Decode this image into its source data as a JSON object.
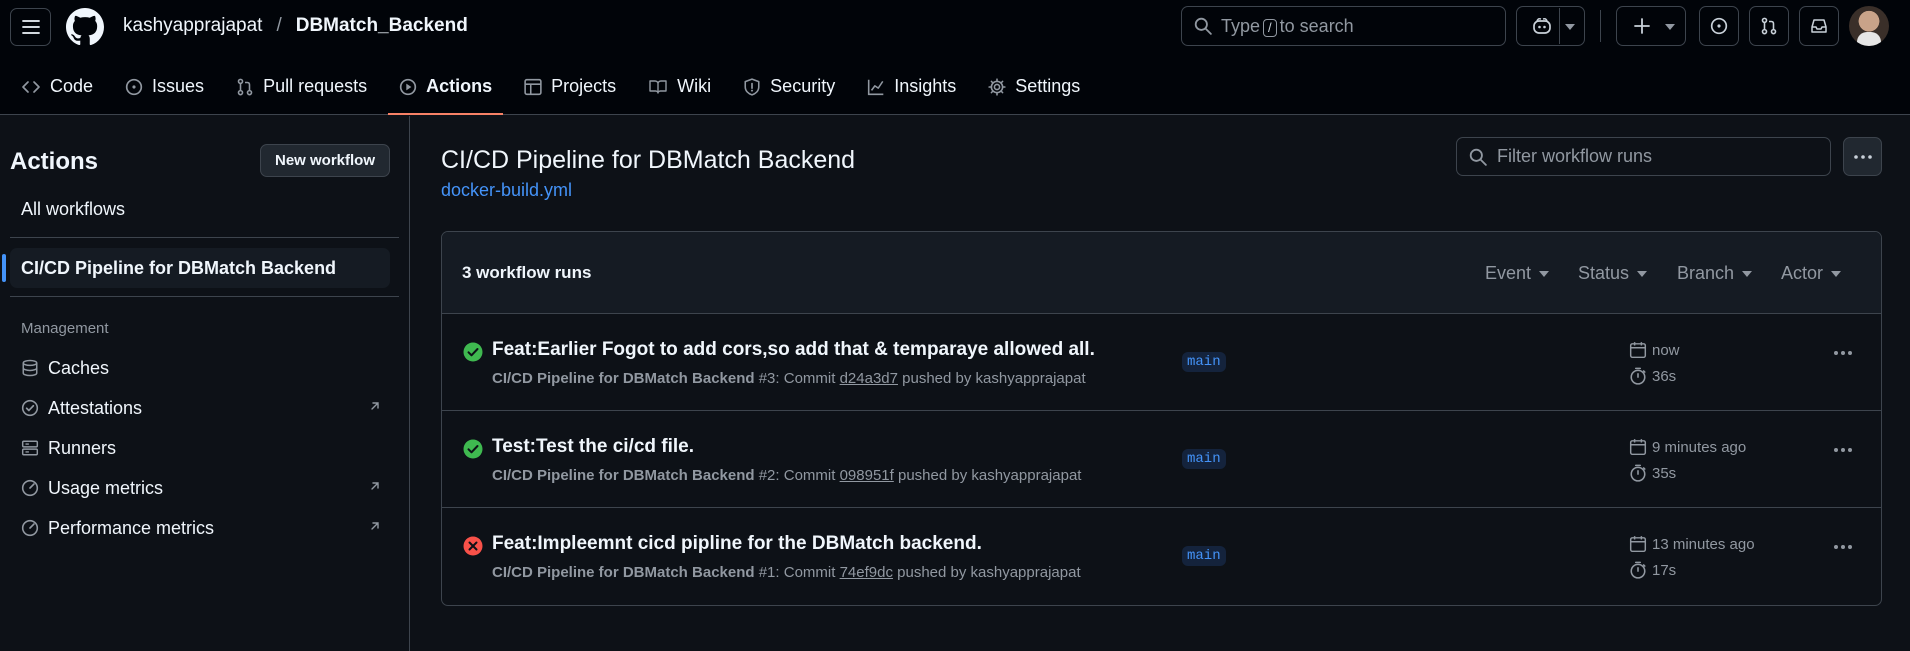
{
  "header": {
    "owner": "kashyapprajapat",
    "separator": "/",
    "repo": "DBMatch_Backend",
    "search_prefix": "Type",
    "search_key": "/",
    "search_suffix": "to search"
  },
  "nav": {
    "tabs": [
      {
        "label": "Code",
        "icon": "code-icon"
      },
      {
        "label": "Issues",
        "icon": "issue-icon"
      },
      {
        "label": "Pull requests",
        "icon": "pull-request-icon"
      },
      {
        "label": "Actions",
        "icon": "play-icon",
        "active": true
      },
      {
        "label": "Projects",
        "icon": "table-icon"
      },
      {
        "label": "Wiki",
        "icon": "book-icon"
      },
      {
        "label": "Security",
        "icon": "shield-icon"
      },
      {
        "label": "Insights",
        "icon": "graph-icon"
      },
      {
        "label": "Settings",
        "icon": "gear-icon"
      }
    ]
  },
  "sidebar": {
    "title": "Actions",
    "new_workflow": "New workflow",
    "all_workflows": "All workflows",
    "active_workflow": "CI/CD Pipeline for DBMatch Backend",
    "management_heading": "Management",
    "items": [
      {
        "label": "Caches",
        "icon": "cache-icon"
      },
      {
        "label": "Attestations",
        "icon": "verified-icon",
        "external": true
      },
      {
        "label": "Runners",
        "icon": "server-icon"
      },
      {
        "label": "Usage metrics",
        "icon": "meter-icon",
        "external": true
      },
      {
        "label": "Performance metrics",
        "icon": "meter-icon",
        "external": true
      }
    ]
  },
  "main": {
    "title": "CI/CD Pipeline for DBMatch Backend",
    "file": "docker-build.yml",
    "filter_placeholder": "Filter workflow runs",
    "runs_count": "3 workflow runs",
    "filters": [
      "Event",
      "Status",
      "Branch",
      "Actor"
    ],
    "runs": [
      {
        "status": "success",
        "title": "Feat:Earlier Fogot to add cors,so add that & temparaye allowed all.",
        "workflow": "CI/CD Pipeline for DBMatch Backend",
        "number": "#3: Commit",
        "sha": "d24a3d7",
        "pushed_by": "pushed by kashyapprajapat",
        "branch": "main",
        "when": "now",
        "duration": "36s"
      },
      {
        "status": "success",
        "title": "Test:Test the ci/cd file.",
        "workflow": "CI/CD Pipeline for DBMatch Backend",
        "number": "#2: Commit",
        "sha": "098951f",
        "pushed_by": "pushed by kashyapprajapat",
        "branch": "main",
        "when": "9 minutes ago",
        "duration": "35s"
      },
      {
        "status": "failure",
        "title": "Feat:Impleemnt cicd pipline for the DBMatch backend.",
        "workflow": "CI/CD Pipeline for DBMatch Backend",
        "number": "#1: Commit",
        "sha": "74ef9dc",
        "pushed_by": "pushed by kashyapprajapat",
        "branch": "main",
        "when": "13 minutes ago",
        "duration": "17s"
      }
    ]
  },
  "colors": {
    "background": "#0d1117",
    "header_bg": "#010409",
    "border": "#3d444d",
    "link": "#4493f8",
    "success": "#3fb950",
    "failure": "#f85149",
    "active_tab_underline": "#f78166"
  }
}
